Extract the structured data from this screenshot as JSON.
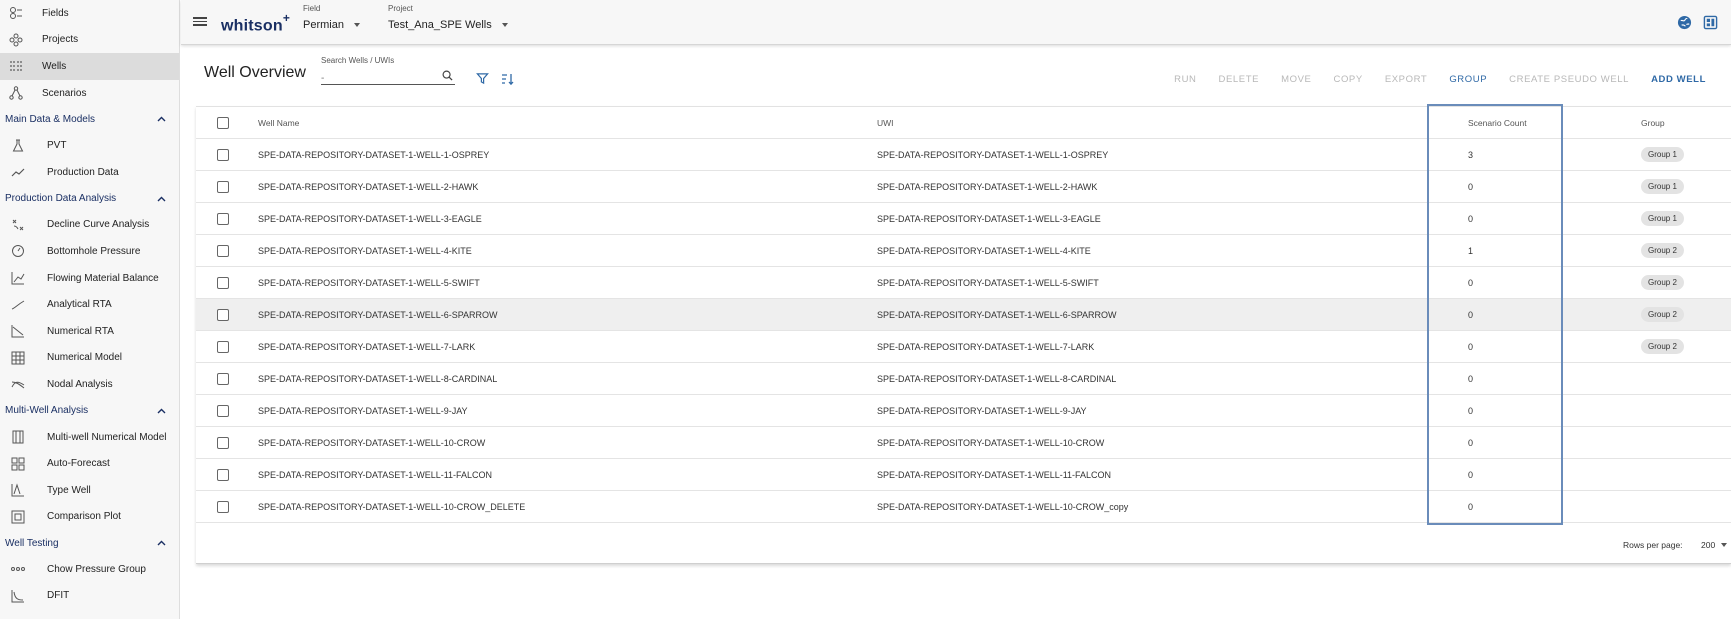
{
  "sidebar": {
    "top_items": [
      {
        "label": "Fields",
        "icon": "fields-icon"
      },
      {
        "label": "Projects",
        "icon": "projects-icon"
      },
      {
        "label": "Wells",
        "icon": "wells-icon",
        "active": true
      },
      {
        "label": "Scenarios",
        "icon": "scenarios-icon"
      }
    ],
    "sections": [
      {
        "title": "Main Data & Models",
        "items": [
          {
            "label": "PVT",
            "icon": "flask-icon"
          },
          {
            "label": "Production Data",
            "icon": "line-chart-icon"
          }
        ]
      },
      {
        "title": "Production Data Analysis",
        "items": [
          {
            "label": "Decline Curve Analysis",
            "icon": "decline-curve-icon"
          },
          {
            "label": "Bottomhole Pressure",
            "icon": "gauge-icon"
          },
          {
            "label": "Flowing Material Balance",
            "icon": "fmb-chart-icon"
          },
          {
            "label": "Analytical RTA",
            "icon": "rta-line-icon"
          },
          {
            "label": "Numerical RTA",
            "icon": "numerical-rta-icon"
          },
          {
            "label": "Numerical Model",
            "icon": "grid-model-icon"
          },
          {
            "label": "Nodal Analysis",
            "icon": "nodal-icon"
          }
        ]
      },
      {
        "title": "Multi-Well Analysis",
        "items": [
          {
            "label": "Multi-well Numerical Model",
            "icon": "multiwell-grid-icon"
          },
          {
            "label": "Auto-Forecast",
            "icon": "auto-forecast-icon"
          },
          {
            "label": "Type Well",
            "icon": "type-well-icon"
          },
          {
            "label": "Comparison Plot",
            "icon": "comparison-plot-icon"
          }
        ]
      },
      {
        "title": "Well Testing",
        "items": [
          {
            "label": "Chow Pressure Group",
            "icon": "chow-icon"
          },
          {
            "label": "DFIT",
            "icon": "dfit-icon"
          }
        ]
      }
    ]
  },
  "header": {
    "logo": "whitson",
    "logo_sup": "+",
    "field_label": "Field",
    "field_value": "Permian",
    "project_label": "Project",
    "project_value": "Test_Ana_SPE Wells"
  },
  "main": {
    "title": "Well Overview",
    "search_label": "Search Wells / UWIs",
    "search_placeholder": "-",
    "actions": [
      {
        "label": "RUN",
        "enabled": false
      },
      {
        "label": "DELETE",
        "enabled": false
      },
      {
        "label": "MOVE",
        "enabled": false
      },
      {
        "label": "COPY",
        "enabled": false
      },
      {
        "label": "EXPORT",
        "enabled": false
      },
      {
        "label": "GROUP",
        "enabled": true,
        "bold": false
      },
      {
        "label": "CREATE PSEUDO WELL",
        "enabled": false
      },
      {
        "label": "ADD WELL",
        "enabled": true,
        "bold": true
      }
    ]
  },
  "table": {
    "columns": [
      "Well Name",
      "UWI",
      "Scenario Count",
      "Group"
    ],
    "rows": [
      {
        "name": "SPE-DATA-REPOSITORY-DATASET-1-WELL-1-OSPREY",
        "uwi": "SPE-DATA-REPOSITORY-DATASET-1-WELL-1-OSPREY",
        "scenarios": "3",
        "group": "Group 1"
      },
      {
        "name": "SPE-DATA-REPOSITORY-DATASET-1-WELL-2-HAWK",
        "uwi": "SPE-DATA-REPOSITORY-DATASET-1-WELL-2-HAWK",
        "scenarios": "0",
        "group": "Group 1"
      },
      {
        "name": "SPE-DATA-REPOSITORY-DATASET-1-WELL-3-EAGLE",
        "uwi": "SPE-DATA-REPOSITORY-DATASET-1-WELL-3-EAGLE",
        "scenarios": "0",
        "group": "Group 1"
      },
      {
        "name": "SPE-DATA-REPOSITORY-DATASET-1-WELL-4-KITE",
        "uwi": "SPE-DATA-REPOSITORY-DATASET-1-WELL-4-KITE",
        "scenarios": "1",
        "group": "Group 2"
      },
      {
        "name": "SPE-DATA-REPOSITORY-DATASET-1-WELL-5-SWIFT",
        "uwi": "SPE-DATA-REPOSITORY-DATASET-1-WELL-5-SWIFT",
        "scenarios": "0",
        "group": "Group 2"
      },
      {
        "name": "SPE-DATA-REPOSITORY-DATASET-1-WELL-6-SPARROW",
        "uwi": "SPE-DATA-REPOSITORY-DATASET-1-WELL-6-SPARROW",
        "scenarios": "0",
        "group": "Group 2",
        "highlight": true
      },
      {
        "name": "SPE-DATA-REPOSITORY-DATASET-1-WELL-7-LARK",
        "uwi": "SPE-DATA-REPOSITORY-DATASET-1-WELL-7-LARK",
        "scenarios": "0",
        "group": "Group 2"
      },
      {
        "name": "SPE-DATA-REPOSITORY-DATASET-1-WELL-8-CARDINAL",
        "uwi": "SPE-DATA-REPOSITORY-DATASET-1-WELL-8-CARDINAL",
        "scenarios": "0",
        "group": ""
      },
      {
        "name": "SPE-DATA-REPOSITORY-DATASET-1-WELL-9-JAY",
        "uwi": "SPE-DATA-REPOSITORY-DATASET-1-WELL-9-JAY",
        "scenarios": "0",
        "group": ""
      },
      {
        "name": "SPE-DATA-REPOSITORY-DATASET-1-WELL-10-CROW",
        "uwi": "SPE-DATA-REPOSITORY-DATASET-1-WELL-10-CROW",
        "scenarios": "0",
        "group": ""
      },
      {
        "name": "SPE-DATA-REPOSITORY-DATASET-1-WELL-11-FALCON",
        "uwi": "SPE-DATA-REPOSITORY-DATASET-1-WELL-11-FALCON",
        "scenarios": "0",
        "group": ""
      },
      {
        "name": "SPE-DATA-REPOSITORY-DATASET-1-WELL-10-CROW_DELETE",
        "uwi": "SPE-DATA-REPOSITORY-DATASET-1-WELL-10-CROW_copy",
        "scenarios": "0",
        "group": ""
      }
    ],
    "footer": {
      "rows_per_page_label": "Rows per page:",
      "rows_per_page_value": "200"
    }
  },
  "colors": {
    "brand": "#1a2f63",
    "accent": "#2f69a6",
    "highlight_box": "#6a8cba",
    "disabled": "#b8b8b8"
  }
}
